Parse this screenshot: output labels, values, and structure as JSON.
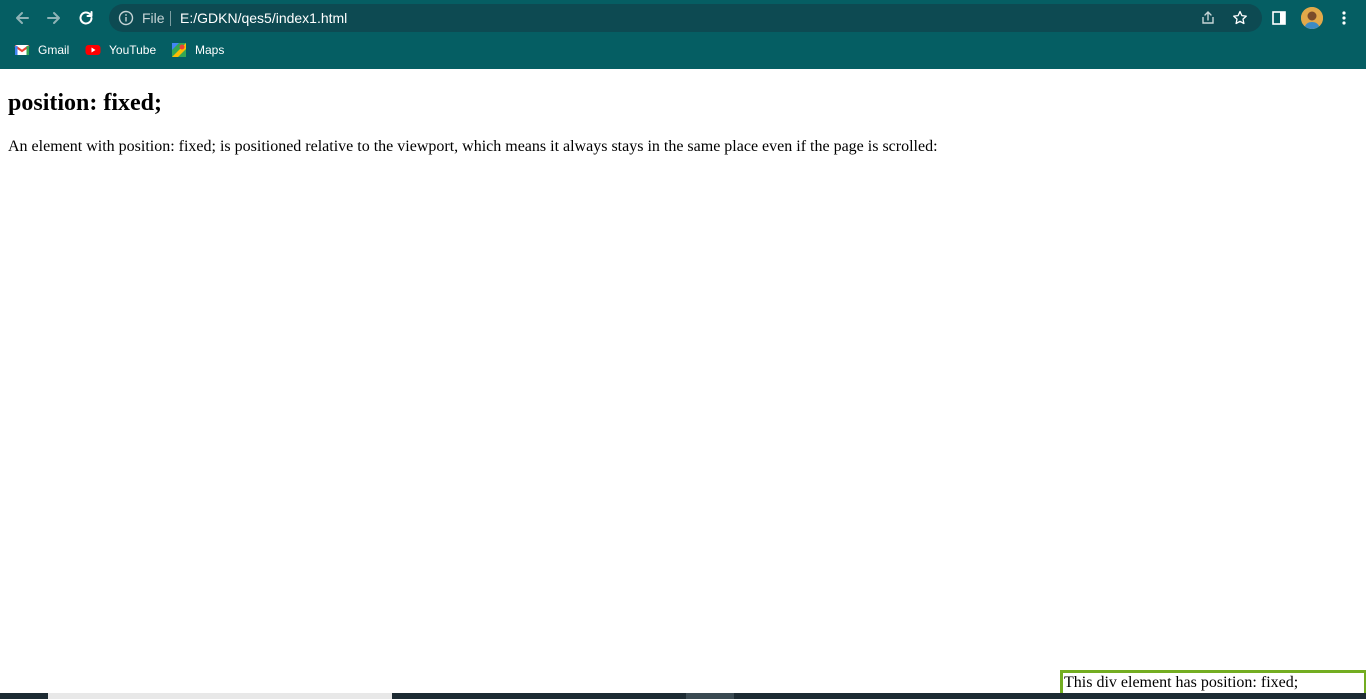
{
  "browser": {
    "omnibox": {
      "scheme_label": "File",
      "url": "E:/GDKN/qes5/index1.html"
    },
    "bookmarks": [
      {
        "label": "Gmail",
        "icon": "gmail-icon"
      },
      {
        "label": "YouTube",
        "icon": "youtube-icon"
      },
      {
        "label": "Maps",
        "icon": "maps-icon"
      }
    ],
    "colors": {
      "frame": "#055e63",
      "omnibox": "#0d4a52"
    }
  },
  "page": {
    "heading": "position: fixed;",
    "paragraph": "An element with position: fixed; is positioned relative to the viewport, which means it always stays in the same place even if the page is scrolled:",
    "fixed_div_text": "This div element has position: fixed;",
    "fixed_div_border_color": "#73ad21"
  }
}
